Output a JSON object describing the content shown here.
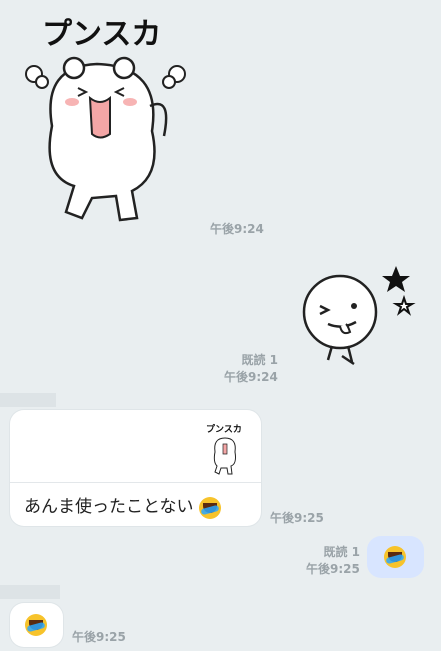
{
  "messages": {
    "m1": {
      "sticker_text": "プンスカ",
      "time": "午後9:24"
    },
    "m2": {
      "read": "既読 1",
      "time": "午後9:24"
    },
    "m3": {
      "preview_text": "プンスカ",
      "text": "あんま使ったことない",
      "time": "午後9:25"
    },
    "m4": {
      "read": "既読 1",
      "time": "午後9:25"
    },
    "m5": {
      "time": "午後9:25"
    }
  },
  "icons": {
    "emoji": "laughing-crying-face-icon"
  },
  "colors": {
    "background": "#e9eef0",
    "bubble_in": "#ffffff",
    "bubble_out": "#d8e5ff",
    "timestamp": "#9aa3a8"
  }
}
